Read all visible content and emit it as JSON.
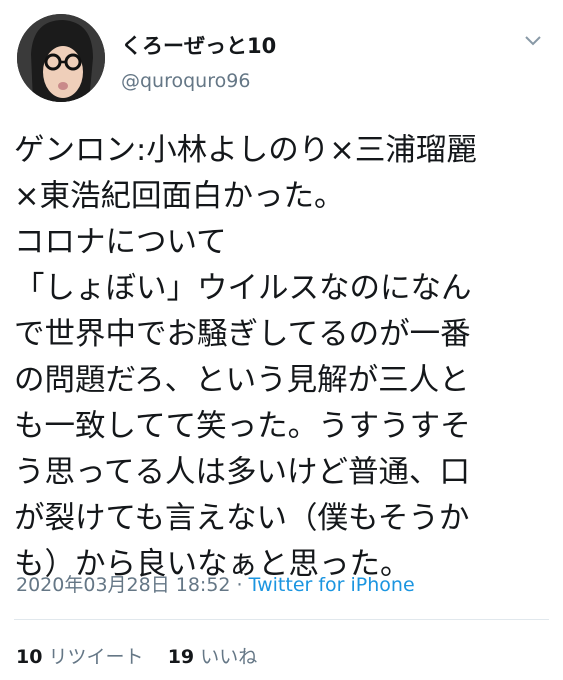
{
  "user": {
    "display_name": "くろーぜっと10",
    "handle": "@quroquro96"
  },
  "tweet": {
    "lines": [
      "ゲンロン:小林よしのり×三浦瑠麗",
      "×東浩紀回面白かった。",
      "コロナについて",
      "「しょぼい」ウイルスなのになん",
      "で世界中でお騒ぎしてるのが一番",
      "の問題だろ、という見解が三人と",
      "も一致してて笑った。うすうすそ",
      "う思ってる人は多いけど普通、口",
      "が裂けても言えない（僕もそうか",
      "も）から良いなぁと思った。"
    ],
    "timestamp": "2020年03月28日 18:52",
    "separator": " · ",
    "source": "Twitter for iPhone"
  },
  "stats": {
    "retweets_count": "10",
    "retweets_label": "リツイート",
    "likes_count": "19",
    "likes_label": "いいね"
  },
  "icons": {
    "caret": "chevron-down-icon",
    "avatar": "avatar"
  },
  "colors": {
    "text": "#14171a",
    "secondary": "#657786",
    "link": "#1b95e0",
    "divider": "#e1e8ed"
  }
}
